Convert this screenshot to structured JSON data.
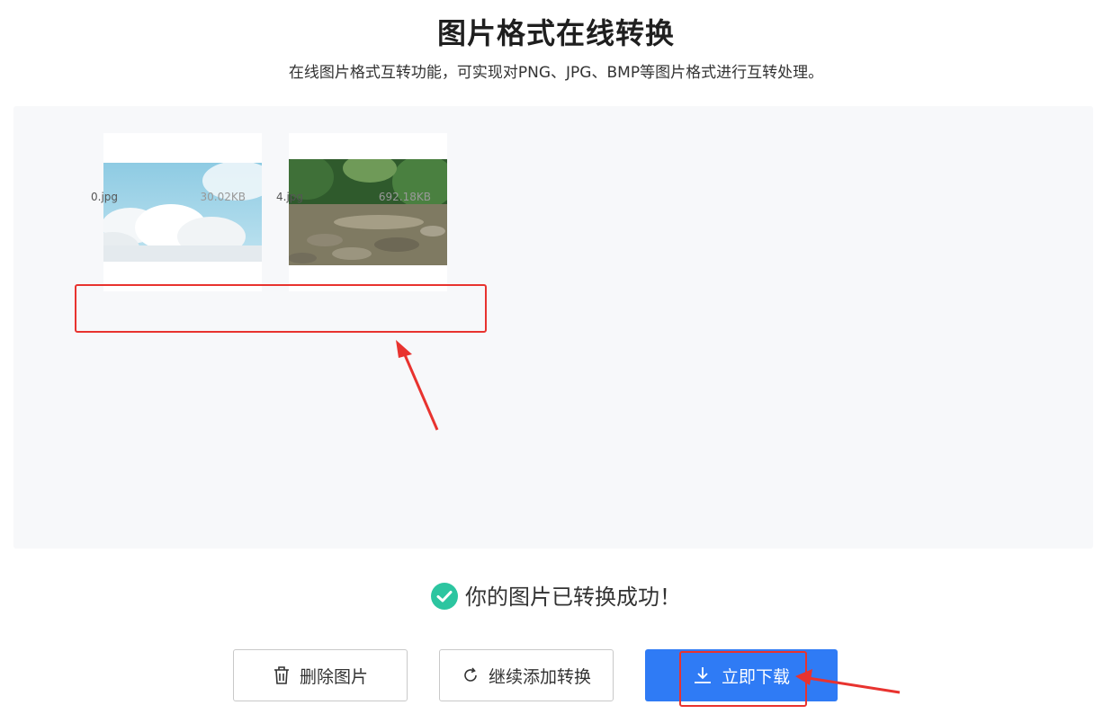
{
  "header": {
    "title": "图片格式在线转换",
    "subtitle": "在线图片格式互转功能，可实现对PNG、JPG、BMP等图片格式进行互转处理。"
  },
  "files": [
    {
      "name": "0.jpg",
      "size": "30.02KB",
      "thumbnail": "sky-clouds"
    },
    {
      "name": "4.jpg",
      "size": "692.18KB",
      "thumbnail": "forest-river"
    }
  ],
  "status": {
    "icon": "check-circle-icon",
    "message": "你的图片已转换成功！"
  },
  "actions": {
    "delete_label": "删除图片",
    "continue_label": "继续添加转换",
    "download_label": "立即下载"
  },
  "colors": {
    "accent": "#2f7bf5",
    "success": "#2cc5a0",
    "annotation": "#e8332f"
  }
}
